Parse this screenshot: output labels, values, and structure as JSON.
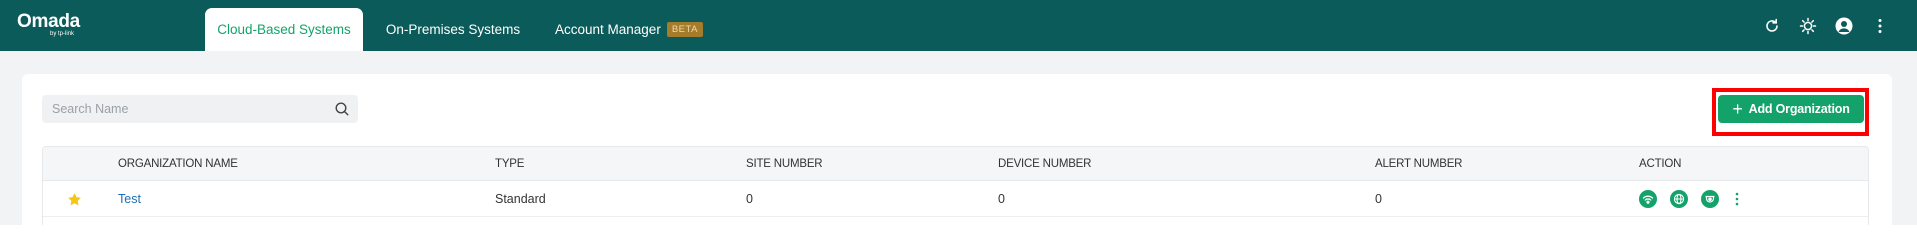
{
  "brand": {
    "name": "Omada",
    "sub": "by tp-link"
  },
  "tabs": [
    {
      "label": "Cloud-Based Systems",
      "active": true
    },
    {
      "label": "On-Premises Systems",
      "active": false
    },
    {
      "label": "Account Manager",
      "badge": "BETA",
      "active": false
    }
  ],
  "toolbar_icons": [
    "refresh-icon",
    "theme-sun-icon",
    "user-avatar-icon",
    "more-vertical-icon"
  ],
  "search": {
    "placeholder": "Search Name",
    "value": ""
  },
  "add_button": {
    "label": "Add Organization",
    "icon": "plus-icon"
  },
  "table": {
    "columns": [
      "ORGANIZATION NAME",
      "TYPE",
      "SITE NUMBER",
      "DEVICE NUMBER",
      "ALERT NUMBER",
      "ACTION"
    ],
    "rows": [
      {
        "favorite": true,
        "name": "Test",
        "type": "Standard",
        "site_number": "0",
        "device_number": "0",
        "alert_number": "0",
        "actions": [
          "wireless-icon",
          "globe-icon",
          "camera-icon",
          "more-vertical-icon"
        ]
      }
    ]
  },
  "colors": {
    "topbar": "#0b5b5a",
    "accent": "#14a26b",
    "link": "#1f6fb8",
    "star": "#f5c518",
    "highlight": "#ff0000",
    "beta_badge": "#a57c2b"
  }
}
